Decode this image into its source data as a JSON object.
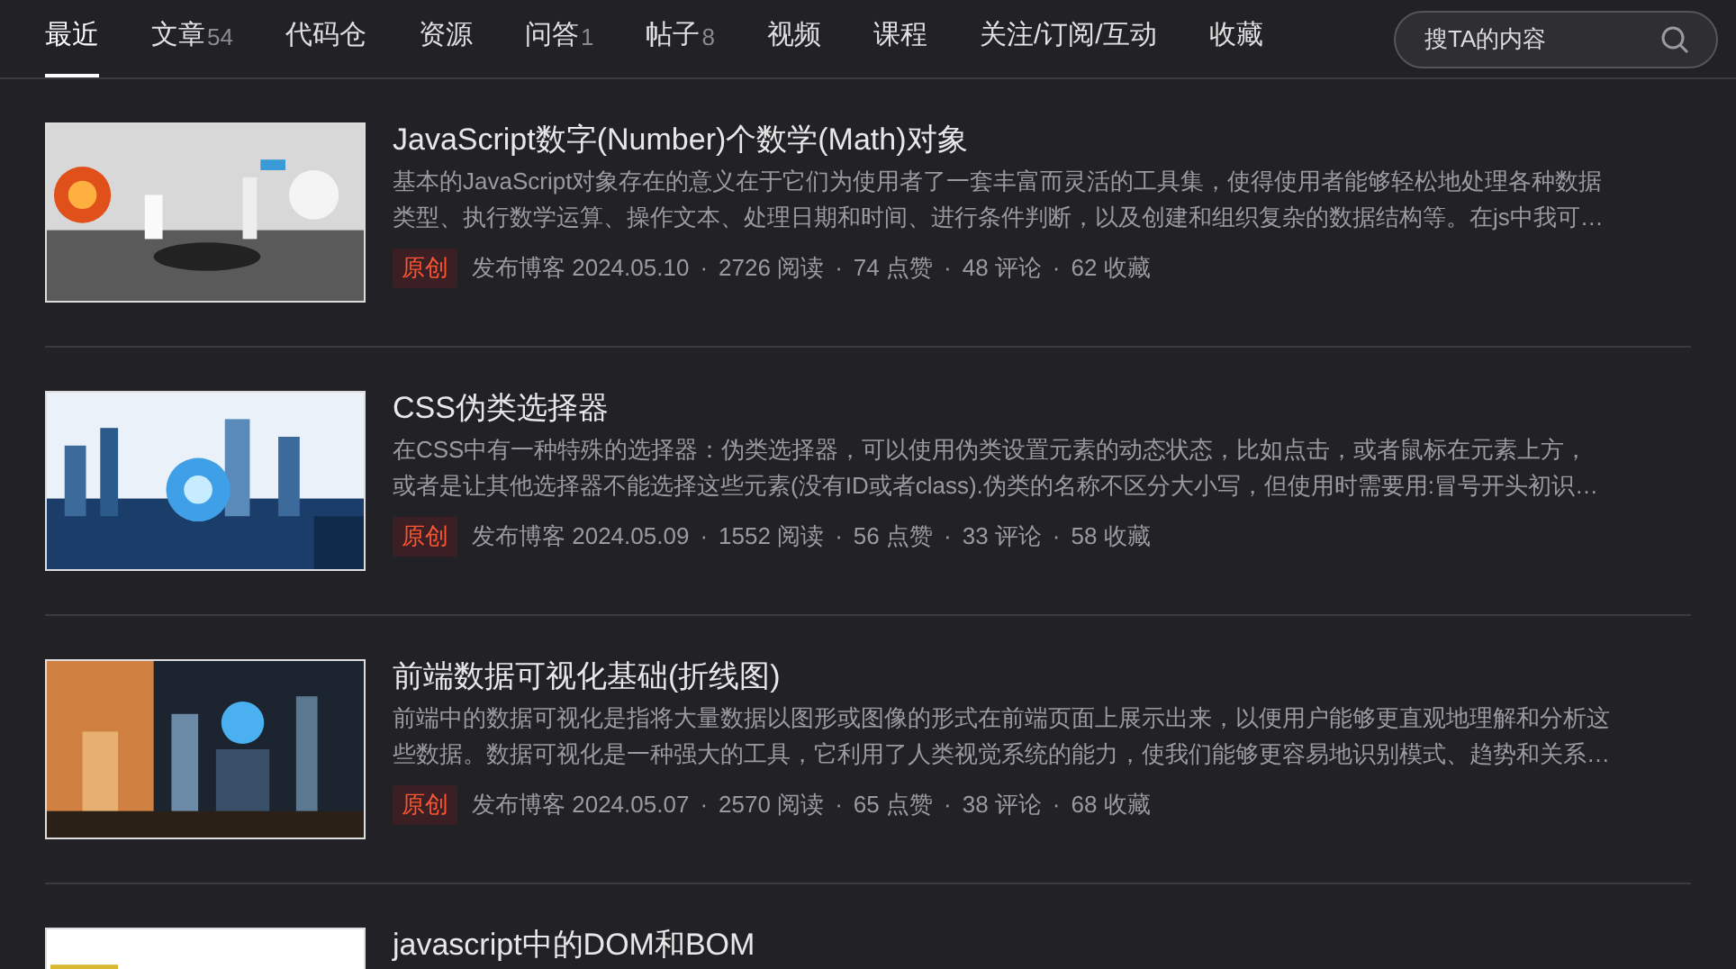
{
  "tabs": [
    {
      "label": "最近",
      "selected": true
    },
    {
      "label": "文章",
      "count": "54",
      "selected": false
    },
    {
      "label": "代码仓",
      "selected": false
    },
    {
      "label": "资源",
      "selected": false
    },
    {
      "label": "问答",
      "count": "1",
      "selected": false
    },
    {
      "label": "帖子",
      "count": "8",
      "selected": false
    },
    {
      "label": "视频",
      "selected": false
    },
    {
      "label": "课程",
      "selected": false
    },
    {
      "label": "关注/订阅/互动",
      "selected": false
    },
    {
      "label": "收藏",
      "selected": false
    }
  ],
  "search": {
    "placeholder": "搜TA的内容"
  },
  "articles": [
    {
      "title": "JavaScript数字(Number)个数学(Math)对象",
      "summary_lines": [
        "基本的JavaScript对象存在的意义在于它们为使用者了一套丰富而灵活的工具集，使得使用者能够轻松地处理各种数据",
        "类型、执行数学运算、操作文本、处理日期和时间、进行条件判断，以及创建和组织复杂的数据结构等。在js中我可…"
      ],
      "separator": "·",
      "tag": "原创",
      "published": "发布博客 2024.05.10",
      "reads": "2726 阅读",
      "likes": "74 点赞",
      "comments": "48 评论",
      "favorites": "62 收藏"
    },
    {
      "title": "CSS伪类选择器",
      "summary_lines": [
        "在CSS中有一种特殊的选择器：伪类选择器，可以使用伪类设置元素的动态状态，比如点击，或者鼠标在元素上方，",
        "或者是让其他选择器不能选择这些元素(没有ID或者class).伪类的名称不区分大小写，但使用时需要用:冒号开头初识…"
      ],
      "separator": "·",
      "tag": "原创",
      "published": "发布博客 2024.05.09",
      "reads": "1552 阅读",
      "likes": "56 点赞",
      "comments": "33 评论",
      "favorites": "58 收藏"
    },
    {
      "title": "前端数据可视化基础(折线图)",
      "summary_lines": [
        "前端中的数据可视化是指将大量数据以图形或图像的形式在前端页面上展示出来，以便用户能够更直观地理解和分析这",
        "些数据。数据可视化是一种强大的工具，它利用了人类视觉系统的能力，使我们能够更容易地识别模式、趋势和关系…"
      ],
      "separator": "·",
      "tag": "原创",
      "published": "发布博客 2024.05.07",
      "reads": "2570 阅读",
      "likes": "65 点赞",
      "comments": "38 评论",
      "favorites": "68 收藏"
    },
    {
      "title": "javascript中的DOM和BOM"
    }
  ]
}
